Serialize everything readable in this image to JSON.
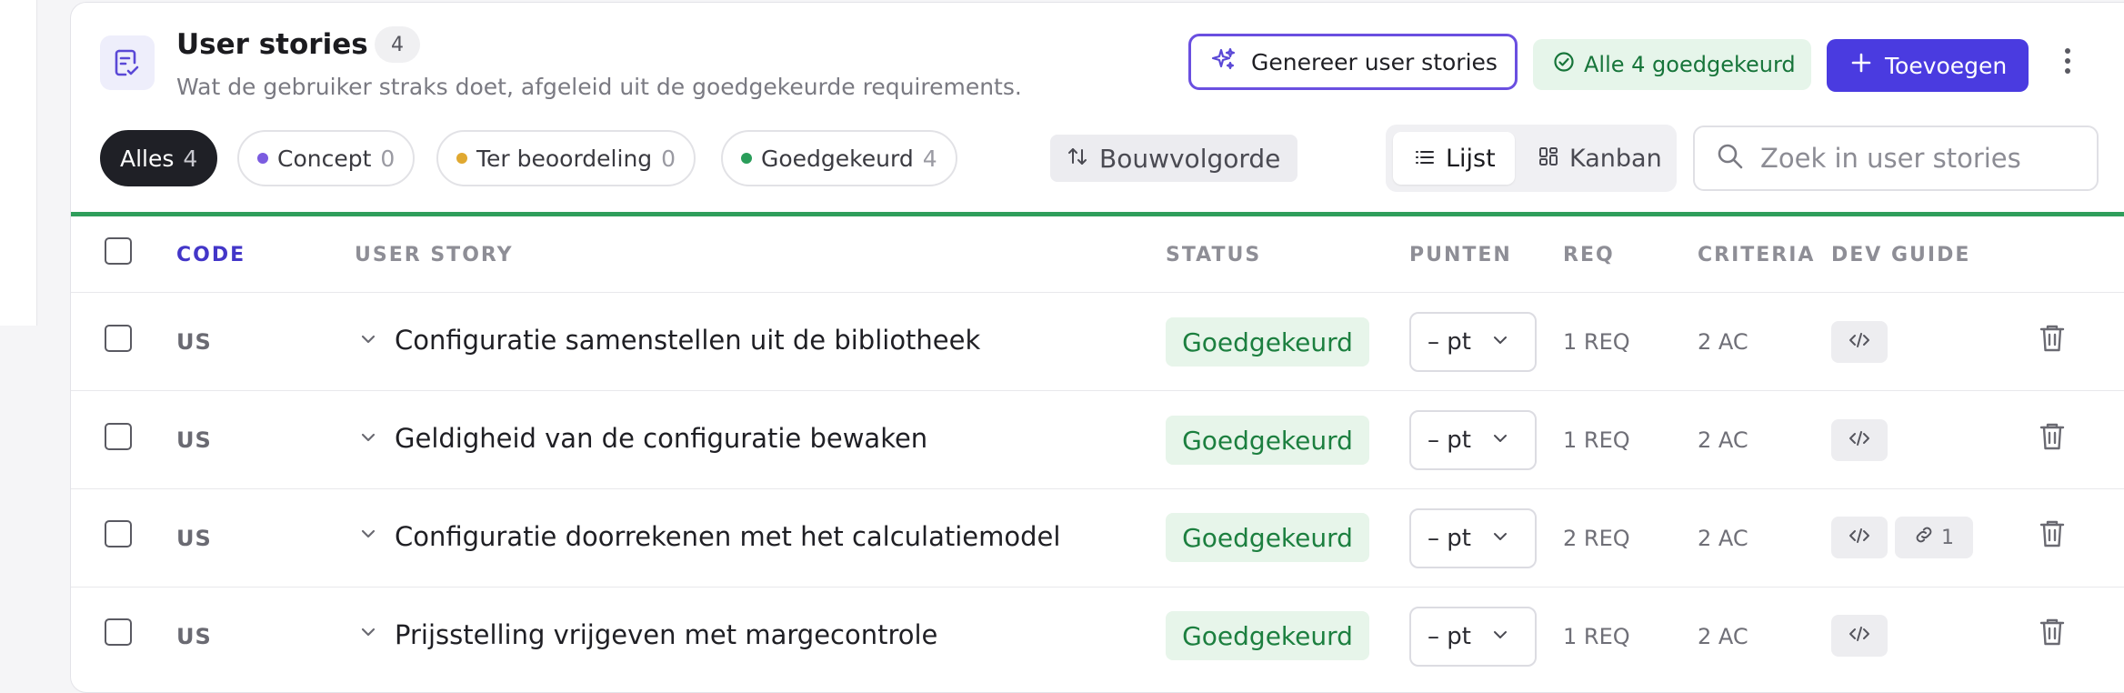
{
  "header": {
    "title": "User stories",
    "count": "4",
    "subtitle": "Wat de gebruiker straks doet, afgeleid uit de goedgekeurde requirements.",
    "generate_label": "Genereer user stories",
    "approved_label": "Alle 4 goedgekeurd",
    "add_label": "Toevoegen"
  },
  "filters": [
    {
      "label": "Alles",
      "count": "4",
      "active": true
    },
    {
      "label": "Concept",
      "count": "0",
      "dot": "#7b5ce0"
    },
    {
      "label": "Ter beoordeling",
      "count": "0",
      "dot": "#e0a830"
    },
    {
      "label": "Goedgekeurd",
      "count": "4",
      "dot": "#2a9d5a"
    }
  ],
  "sort_label": "Bouwvolgorde",
  "views": [
    {
      "label": "Lijst",
      "active": true
    },
    {
      "label": "Kanban"
    }
  ],
  "search": {
    "placeholder": "Zoek in user stories"
  },
  "columns": {
    "code": "CODE",
    "story": "USER STORY",
    "status": "STATUS",
    "points": "PUNTEN",
    "req": "REQ",
    "criteria": "CRITERIA",
    "dev_guide": "DEV GUIDE"
  },
  "rows": [
    {
      "code": "US",
      "story": "Configuratie samenstellen uit de bibliotheek",
      "status": "Goedgekeurd",
      "points": "– pt",
      "req": "1 REQ",
      "criteria": "2 AC"
    },
    {
      "code": "US",
      "story": "Geldigheid van de configuratie bewaken",
      "status": "Goedgekeurd",
      "points": "– pt",
      "req": "1 REQ",
      "criteria": "2 AC"
    },
    {
      "code": "US",
      "story": "Configuratie doorrekenen met het calculatiemodel",
      "status": "Goedgekeurd",
      "points": "– pt",
      "req": "2 REQ",
      "criteria": "2 AC",
      "links": "1"
    },
    {
      "code": "US",
      "story": "Prijsstelling vrijgeven met margecontrole",
      "status": "Goedgekeurd",
      "points": "– pt",
      "req": "1 REQ",
      "criteria": "2 AC"
    }
  ],
  "colors": {
    "accent": "#4a3be0",
    "approved_bg": "#e7f5ea",
    "approved_text": "#1c7f3f",
    "divider": "#2f9e5b"
  },
  "icons": {
    "header": "clipboard-check-icon",
    "generate": "sparkles-icon",
    "approved": "check-circle-icon",
    "add": "plus-icon",
    "menu": "kebab-icon",
    "sort": "sort-arrows-icon",
    "list": "list-icon",
    "kanban": "kanban-icon",
    "search": "search-icon",
    "help": "help-icon",
    "expand": "chevron-down-icon",
    "dev_guide": "code-icon",
    "link": "link-icon",
    "delete": "trash-icon"
  }
}
